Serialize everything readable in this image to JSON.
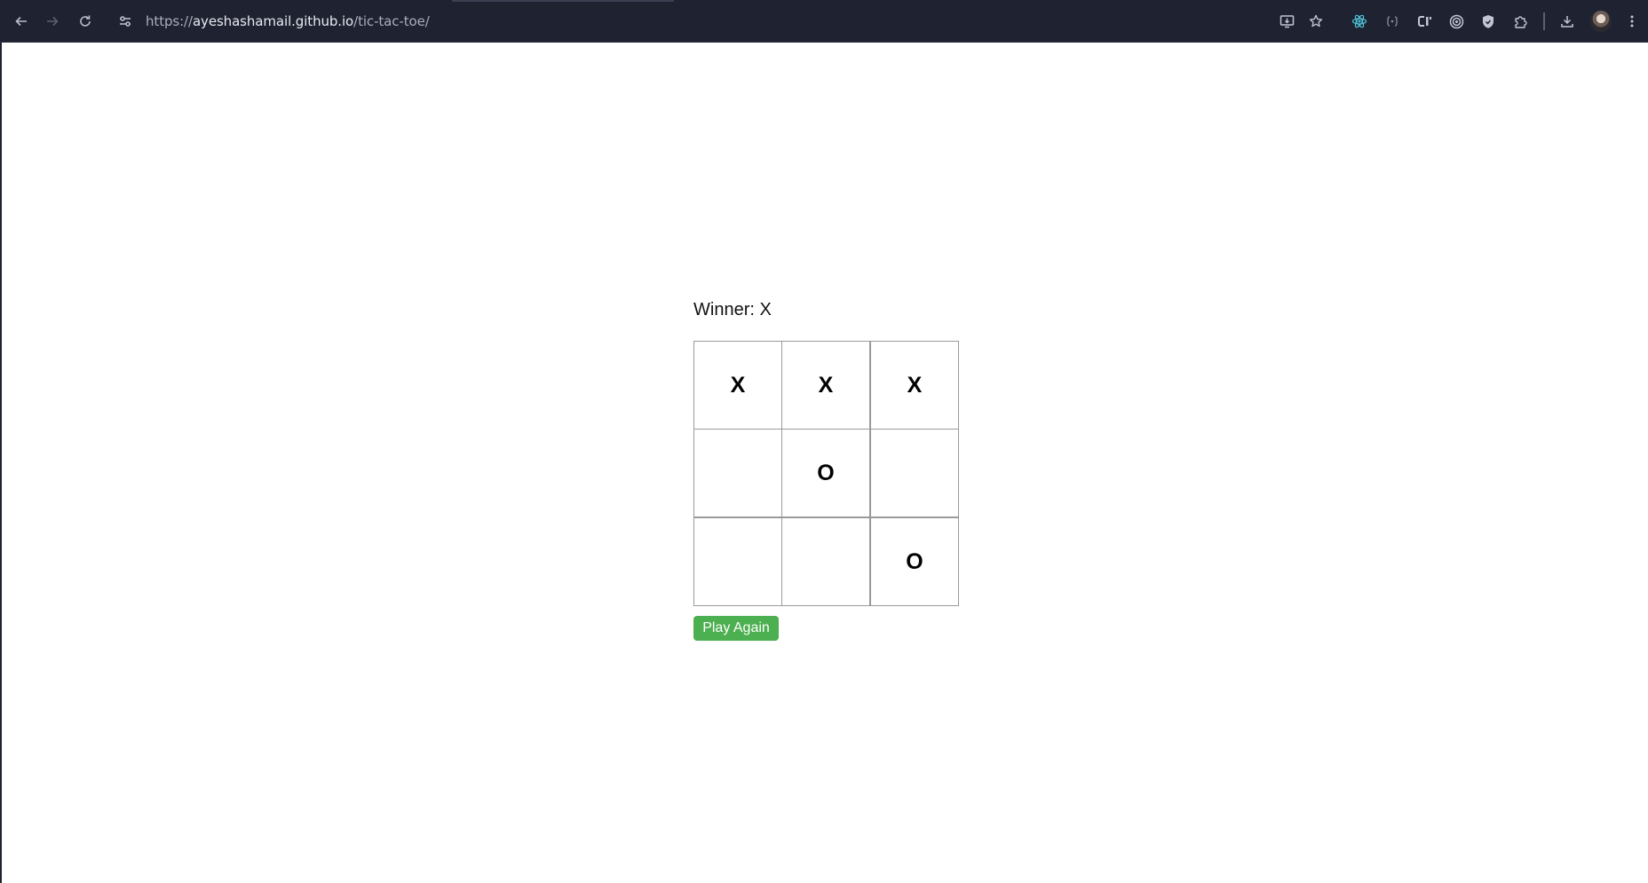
{
  "browser": {
    "url_scheme": "https://",
    "url_host": "ayeshashamail.github.io",
    "url_path": "/tic-tac-toe/",
    "icons": {
      "back": "back-arrow-icon",
      "forward": "forward-arrow-icon",
      "reload": "reload-icon",
      "site_info": "site-controls-icon",
      "install": "install-app-icon",
      "bookmark": "star-icon",
      "extensions": [
        "react-devtools-icon",
        "extension-brackets-icon",
        "extension-ci-icon",
        "extension-target-icon",
        "extension-shield-icon",
        "puzzle-icon"
      ],
      "download": "download-icon",
      "menu": "kebab-menu-icon"
    }
  },
  "game": {
    "status": "Winner: X",
    "board": [
      "X",
      "X",
      "X",
      "",
      "O",
      "",
      "",
      "",
      "O"
    ],
    "play_again_label": "Play Again",
    "colors": {
      "button_bg": "#4caf50",
      "button_text": "#ffffff",
      "cell_border": "#9a9a9a"
    }
  }
}
